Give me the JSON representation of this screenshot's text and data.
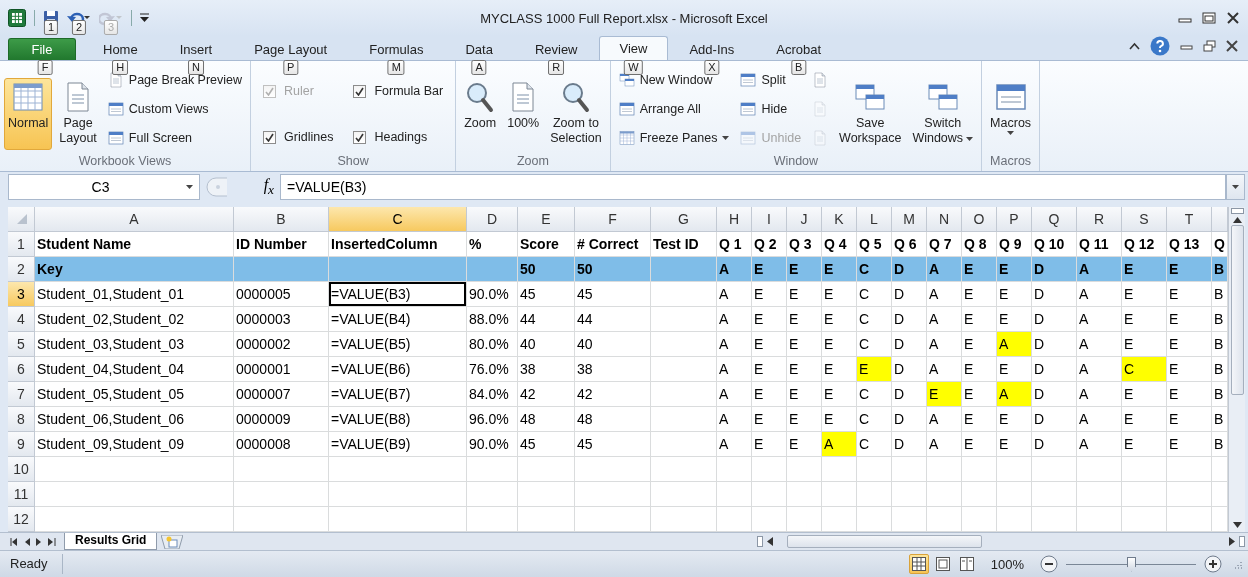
{
  "window": {
    "title": "MYCLASS 1000 Full Report.xlsx - Microsoft Excel"
  },
  "quick_access": [
    {
      "keytip": "1",
      "disabled": false
    },
    {
      "keytip": "2",
      "disabled": false
    },
    {
      "keytip": "3",
      "disabled": true
    }
  ],
  "ribbon_tabs": [
    {
      "kind": "file",
      "label": "File",
      "keytip": "F",
      "selected": false
    },
    {
      "kind": "tab",
      "label": "Home",
      "keytip": "H",
      "selected": false
    },
    {
      "kind": "tab",
      "label": "Insert",
      "keytip": "N",
      "selected": false
    },
    {
      "kind": "tab",
      "label": "Page Layout",
      "keytip": "P",
      "selected": false
    },
    {
      "kind": "tab",
      "label": "Formulas",
      "keytip": "M",
      "selected": false
    },
    {
      "kind": "tab",
      "label": "Data",
      "keytip": "A",
      "selected": false
    },
    {
      "kind": "tab",
      "label": "Review",
      "keytip": "R",
      "selected": false
    },
    {
      "kind": "tab",
      "label": "View",
      "keytip": "W",
      "selected": true
    },
    {
      "kind": "tab",
      "label": "Add-Ins",
      "keytip": "X",
      "selected": false
    },
    {
      "kind": "tab",
      "label": "Acrobat",
      "keytip": "B",
      "selected": false
    }
  ],
  "ribbon_groups": [
    {
      "label": "Workbook Views",
      "items": [
        {
          "kind": "large",
          "label": "Normal",
          "selected": true
        },
        {
          "kind": "large",
          "label": "Page Layout",
          "selected": false
        },
        {
          "kind": "small",
          "label": "Page Break Preview",
          "selected": false
        },
        {
          "kind": "small",
          "label": "Custom Views",
          "selected": false
        },
        {
          "kind": "small",
          "label": "Full Screen",
          "selected": false
        }
      ]
    },
    {
      "label": "Show",
      "items": [
        {
          "kind": "check",
          "label": "Ruler",
          "checked": true,
          "disabled": true
        },
        {
          "kind": "check",
          "label": "Formula Bar",
          "checked": true,
          "disabled": false
        },
        {
          "kind": "check",
          "label": "Gridlines",
          "checked": true,
          "disabled": false
        },
        {
          "kind": "check",
          "label": "Headings",
          "checked": true,
          "disabled": false
        }
      ]
    },
    {
      "label": "Zoom",
      "items": [
        {
          "kind": "large",
          "label": "Zoom"
        },
        {
          "kind": "large",
          "label": "100%"
        },
        {
          "kind": "large",
          "label": "Zoom to Selection"
        }
      ]
    },
    {
      "label": "Window",
      "items": [
        {
          "kind": "small",
          "label": "New Window",
          "disabled": false
        },
        {
          "kind": "small",
          "label": "Arrange All",
          "disabled": false
        },
        {
          "kind": "small",
          "label": "Freeze Panes",
          "disabled": false,
          "dropdown": true
        },
        {
          "kind": "small",
          "label": "Split",
          "disabled": false
        },
        {
          "kind": "small",
          "label": "Hide",
          "disabled": false
        },
        {
          "kind": "small",
          "label": "Unhide",
          "disabled": true
        },
        {
          "kind": "icon",
          "disabled": false
        },
        {
          "kind": "icon",
          "disabled": true
        },
        {
          "kind": "icon",
          "disabled": true
        },
        {
          "kind": "large",
          "label": "Save Workspace",
          "disabled": false
        },
        {
          "kind": "large",
          "label": "Switch Windows",
          "disabled": false,
          "dropdown": true
        }
      ]
    },
    {
      "label": "Macros",
      "items": [
        {
          "kind": "large",
          "label": "Macros",
          "dropdown": true
        }
      ]
    }
  ],
  "formula_bar": {
    "name_box": "C3",
    "function_label": "f$_{x}$",
    "formula": "=VALUE(B3)"
  },
  "grid": {
    "columns": [
      {
        "label": "A",
        "selected": false
      },
      {
        "label": "B",
        "selected": false
      },
      {
        "label": "C",
        "selected": true
      },
      {
        "label": "D",
        "selected": false
      },
      {
        "label": "E",
        "selected": false
      },
      {
        "label": "F",
        "selected": false
      },
      {
        "label": "G",
        "selected": false
      },
      {
        "label": "H",
        "selected": false
      },
      {
        "label": "I",
        "selected": false
      },
      {
        "label": "J",
        "selected": false
      },
      {
        "label": "K",
        "selected": false
      },
      {
        "label": "L",
        "selected": false
      },
      {
        "label": "M",
        "selected": false
      },
      {
        "label": "N",
        "selected": false
      },
      {
        "label": "O",
        "selected": false
      },
      {
        "label": "P",
        "selected": false
      },
      {
        "label": "Q",
        "selected": false
      },
      {
        "label": "R",
        "selected": false
      },
      {
        "label": "S",
        "selected": false
      },
      {
        "label": "T",
        "selected": false
      }
    ],
    "rows": [
      {
        "number": "1",
        "kind": "header",
        "selected": false,
        "cells": [
          "Student Name",
          "ID Number",
          "InsertedColumn",
          "%",
          "Score",
          "# Correct",
          "Test ID",
          "Q 1",
          "Q 2",
          "Q 3",
          "Q 4",
          "Q 5",
          "Q 6",
          "Q 7",
          "Q 8",
          "Q 9",
          "Q 10",
          "Q 11",
          "Q 12",
          "Q 13",
          "Q"
        ]
      },
      {
        "number": "2",
        "kind": "key",
        "selected": false,
        "cells": [
          "Key",
          null,
          null,
          null,
          "50",
          "50",
          null,
          "A",
          "E",
          "E",
          "E",
          "C",
          "D",
          "A",
          "E",
          "E",
          "D",
          "A",
          "E",
          "E",
          "B"
        ]
      },
      {
        "number": "3",
        "kind": "data",
        "selected": true,
        "cells": [
          "Student_01,Student_01",
          "0000005",
          "=VALUE(B3)",
          "90.0%",
          "45",
          "45",
          null,
          "A",
          "E",
          "E",
          "E",
          "C",
          "D",
          "A",
          "E",
          "E",
          "D",
          "A",
          "E",
          "E",
          "B"
        ],
        "highlighted": [
          false,
          false,
          false,
          false,
          false,
          false,
          false,
          false,
          false,
          false,
          false,
          false,
          false,
          false,
          false,
          false,
          false,
          false,
          false,
          false,
          false
        ]
      },
      {
        "number": "4",
        "kind": "data",
        "selected": false,
        "cells": [
          "Student_02,Student_02",
          "0000003",
          "=VALUE(B4)",
          "88.0%",
          "44",
          "44",
          null,
          "A",
          "E",
          "E",
          "E",
          "C",
          "D",
          "A",
          "E",
          "E",
          "D",
          "A",
          "E",
          "E",
          "B"
        ],
        "highlighted": [
          false,
          false,
          false,
          false,
          false,
          false,
          false,
          false,
          false,
          false,
          false,
          false,
          false,
          false,
          false,
          false,
          false,
          false,
          false,
          false,
          false
        ]
      },
      {
        "number": "5",
        "kind": "data",
        "selected": false,
        "cells": [
          "Student_03,Student_03",
          "0000002",
          "=VALUE(B5)",
          "80.0%",
          "40",
          "40",
          null,
          "A",
          "E",
          "E",
          "E",
          "C",
          "D",
          "A",
          "E",
          "A",
          "D",
          "A",
          "E",
          "E",
          "B"
        ],
        "highlighted": [
          false,
          false,
          false,
          false,
          false,
          false,
          false,
          false,
          false,
          false,
          false,
          false,
          false,
          false,
          false,
          true,
          false,
          false,
          false,
          false,
          false
        ]
      },
      {
        "number": "6",
        "kind": "data",
        "selected": false,
        "cells": [
          "Student_04,Student_04",
          "0000001",
          "=VALUE(B6)",
          "76.0%",
          "38",
          "38",
          null,
          "A",
          "E",
          "E",
          "E",
          "E",
          "D",
          "A",
          "E",
          "E",
          "D",
          "A",
          "C",
          "E",
          "B"
        ],
        "highlighted": [
          false,
          false,
          false,
          false,
          false,
          false,
          false,
          false,
          false,
          false,
          false,
          true,
          false,
          false,
          false,
          false,
          false,
          false,
          true,
          false,
          false
        ]
      },
      {
        "number": "7",
        "kind": "data",
        "selected": false,
        "cells": [
          "Student_05,Student_05",
          "0000007",
          "=VALUE(B7)",
          "84.0%",
          "42",
          "42",
          null,
          "A",
          "E",
          "E",
          "E",
          "C",
          "D",
          "E",
          "E",
          "A",
          "D",
          "A",
          "E",
          "E",
          "B"
        ],
        "highlighted": [
          false,
          false,
          false,
          false,
          false,
          false,
          false,
          false,
          false,
          false,
          false,
          false,
          false,
          true,
          false,
          true,
          false,
          false,
          false,
          false,
          false
        ]
      },
      {
        "number": "8",
        "kind": "data",
        "selected": false,
        "cells": [
          "Student_06,Student_06",
          "0000009",
          "=VALUE(B8)",
          "96.0%",
          "48",
          "48",
          null,
          "A",
          "E",
          "E",
          "E",
          "C",
          "D",
          "A",
          "E",
          "E",
          "D",
          "A",
          "E",
          "E",
          "B"
        ],
        "highlighted": [
          false,
          false,
          false,
          false,
          false,
          false,
          false,
          false,
          false,
          false,
          false,
          false,
          false,
          false,
          false,
          false,
          false,
          false,
          false,
          false,
          false
        ]
      },
      {
        "number": "9",
        "kind": "data",
        "selected": false,
        "cells": [
          "Student_09,Student_09",
          "0000008",
          "=VALUE(B9)",
          "90.0%",
          "45",
          "45",
          null,
          "A",
          "E",
          "E",
          "A",
          "C",
          "D",
          "A",
          "E",
          "E",
          "D",
          "A",
          "E",
          "E",
          "B"
        ],
        "highlighted": [
          false,
          false,
          false,
          false,
          false,
          false,
          false,
          false,
          false,
          false,
          true,
          false,
          false,
          false,
          false,
          false,
          false,
          false,
          false,
          false,
          false
        ]
      },
      {
        "number": "10",
        "kind": "empty",
        "selected": false
      },
      {
        "number": "11",
        "kind": "empty",
        "selected": false
      },
      {
        "number": "12",
        "kind": "empty",
        "selected": false
      }
    ]
  },
  "sheet_tabs": [
    {
      "label": "Results Grid",
      "selected": true
    }
  ],
  "status_bar": {
    "text": "Ready",
    "views": [
      {
        "selected": true
      },
      {
        "selected": false
      },
      {
        "selected": false
      }
    ],
    "zoom": "100%",
    "zoom_slider": {
      "level": 0.5
    }
  }
}
